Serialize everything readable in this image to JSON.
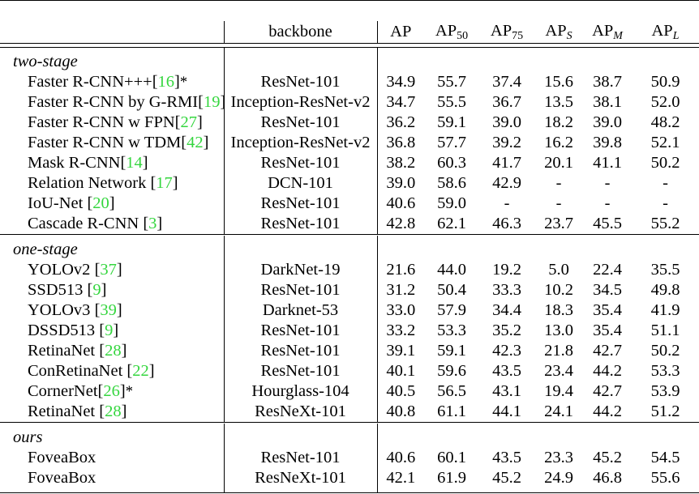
{
  "table": {
    "caption_present": false,
    "accent_citation_color": "#35d63f",
    "rule_color": "#000000",
    "columns": [
      {
        "key": "method",
        "header": ""
      },
      {
        "key": "backbone",
        "header": "backbone"
      },
      {
        "key": "ap",
        "header": "AP",
        "sub": ""
      },
      {
        "key": "ap50",
        "header": "AP",
        "sub": "50"
      },
      {
        "key": "ap75",
        "header": "AP",
        "sub": "75"
      },
      {
        "key": "aps",
        "header": "AP",
        "sub": "S"
      },
      {
        "key": "apm",
        "header": "AP",
        "sub": "M"
      },
      {
        "key": "apl",
        "header": "AP",
        "sub": "L"
      }
    ],
    "sections": [
      {
        "label": "two-stage",
        "rows": [
          {
            "method_pre": "Faster R-CNN+++",
            "cite": "16",
            "method_post": "*",
            "space_before_cite": false,
            "backbone": "ResNet-101",
            "ap": "34.9",
            "ap50": "55.7",
            "ap75": "37.4",
            "aps": "15.6",
            "apm": "38.7",
            "apl": "50.9"
          },
          {
            "method_pre": "Faster R-CNN by G-RMI",
            "cite": "19",
            "method_post": "",
            "space_before_cite": false,
            "backbone": "Inception-ResNet-v2",
            "ap": "34.7",
            "ap50": "55.5",
            "ap75": "36.7",
            "aps": "13.5",
            "apm": "38.1",
            "apl": "52.0"
          },
          {
            "method_pre": "Faster R-CNN w FPN",
            "cite": "27",
            "method_post": "",
            "space_before_cite": false,
            "backbone": "ResNet-101",
            "ap": "36.2",
            "ap50": "59.1",
            "ap75": "39.0",
            "aps": "18.2",
            "apm": "39.0",
            "apl": "48.2"
          },
          {
            "method_pre": "Faster R-CNN w TDM",
            "cite": "42",
            "method_post": "",
            "space_before_cite": false,
            "backbone": "Inception-ResNet-v2",
            "ap": "36.8",
            "ap50": "57.7",
            "ap75": "39.2",
            "aps": "16.2",
            "apm": "39.8",
            "apl": "52.1"
          },
          {
            "method_pre": "Mask R-CNN",
            "cite": "14",
            "method_post": "",
            "space_before_cite": false,
            "backbone": "ResNet-101",
            "ap": "38.2",
            "ap50": "60.3",
            "ap75": "41.7",
            "aps": "20.1",
            "apm": "41.1",
            "apl": "50.2"
          },
          {
            "method_pre": "Relation Network",
            "cite": "17",
            "method_post": "",
            "space_before_cite": true,
            "backbone": "DCN-101",
            "ap": "39.0",
            "ap50": "58.6",
            "ap75": "42.9",
            "aps": "-",
            "apm": "-",
            "apl": "-"
          },
          {
            "method_pre": "IoU-Net",
            "cite": "20",
            "method_post": "",
            "space_before_cite": true,
            "backbone": "ResNet-101",
            "ap": "40.6",
            "ap50": "59.0",
            "ap75": "-",
            "aps": "-",
            "apm": "-",
            "apl": "-"
          },
          {
            "method_pre": "Cascade R-CNN",
            "cite": "3",
            "method_post": "",
            "space_before_cite": true,
            "backbone": "ResNet-101",
            "ap": "42.8",
            "ap50": "62.1",
            "ap75": "46.3",
            "aps": "23.7",
            "apm": "45.5",
            "apl": "55.2"
          }
        ]
      },
      {
        "label": "one-stage",
        "rows": [
          {
            "method_pre": "YOLOv2",
            "cite": "37",
            "method_post": "",
            "space_before_cite": true,
            "backbone": "DarkNet-19",
            "ap": "21.6",
            "ap50": "44.0",
            "ap75": "19.2",
            "aps": "5.0",
            "apm": "22.4",
            "apl": "35.5"
          },
          {
            "method_pre": "SSD513",
            "cite": "9",
            "method_post": "",
            "space_before_cite": true,
            "backbone": "ResNet-101",
            "ap": "31.2",
            "ap50": "50.4",
            "ap75": "33.3",
            "aps": "10.2",
            "apm": "34.5",
            "apl": "49.8"
          },
          {
            "method_pre": "YOLOv3",
            "cite": "39",
            "method_post": "",
            "space_before_cite": true,
            "backbone": "Darknet-53",
            "ap": "33.0",
            "ap50": "57.9",
            "ap75": "34.4",
            "aps": "18.3",
            "apm": "35.4",
            "apl": "41.9"
          },
          {
            "method_pre": "DSSD513",
            "cite": "9",
            "method_post": "",
            "space_before_cite": true,
            "backbone": "ResNet-101",
            "ap": "33.2",
            "ap50": "53.3",
            "ap75": "35.2",
            "aps": "13.0",
            "apm": "35.4",
            "apl": "51.1"
          },
          {
            "method_pre": "RetinaNet",
            "cite": "28",
            "method_post": "",
            "space_before_cite": true,
            "backbone": "ResNet-101",
            "ap": "39.1",
            "ap50": "59.1",
            "ap75": "42.3",
            "aps": "21.8",
            "apm": "42.7",
            "apl": "50.2"
          },
          {
            "method_pre": "ConRetinaNet",
            "cite": "22",
            "method_post": "",
            "space_before_cite": true,
            "backbone": "ResNet-101",
            "ap": "40.1",
            "ap50": "59.6",
            "ap75": "43.5",
            "aps": "23.4",
            "apm": "44.2",
            "apl": "53.3"
          },
          {
            "method_pre": "CornerNet",
            "cite": "26",
            "method_post": "*",
            "space_before_cite": false,
            "backbone": "Hourglass-104",
            "ap": "40.5",
            "ap50": "56.5",
            "ap75": "43.1",
            "aps": "19.4",
            "apm": "42.7",
            "apl": "53.9"
          },
          {
            "method_pre": "RetinaNet",
            "cite": "28",
            "method_post": "",
            "space_before_cite": true,
            "backbone": "ResNeXt-101",
            "ap": "40.8",
            "ap50": "61.1",
            "ap75": "44.1",
            "aps": "24.1",
            "apm": "44.2",
            "apl": "51.2"
          }
        ]
      },
      {
        "label": "ours",
        "rows": [
          {
            "method_pre": "FoveaBox",
            "cite": "",
            "method_post": "",
            "space_before_cite": false,
            "backbone": "ResNet-101",
            "ap": "40.6",
            "ap50": "60.1",
            "ap75": "43.5",
            "aps": "23.3",
            "apm": "45.2",
            "apl": "54.5"
          },
          {
            "method_pre": "FoveaBox",
            "cite": "",
            "method_post": "",
            "space_before_cite": false,
            "backbone": "ResNeXt-101",
            "ap": "42.1",
            "ap50": "61.9",
            "ap75": "45.2",
            "aps": "24.9",
            "apm": "46.8",
            "apl": "55.6"
          }
        ]
      }
    ]
  }
}
